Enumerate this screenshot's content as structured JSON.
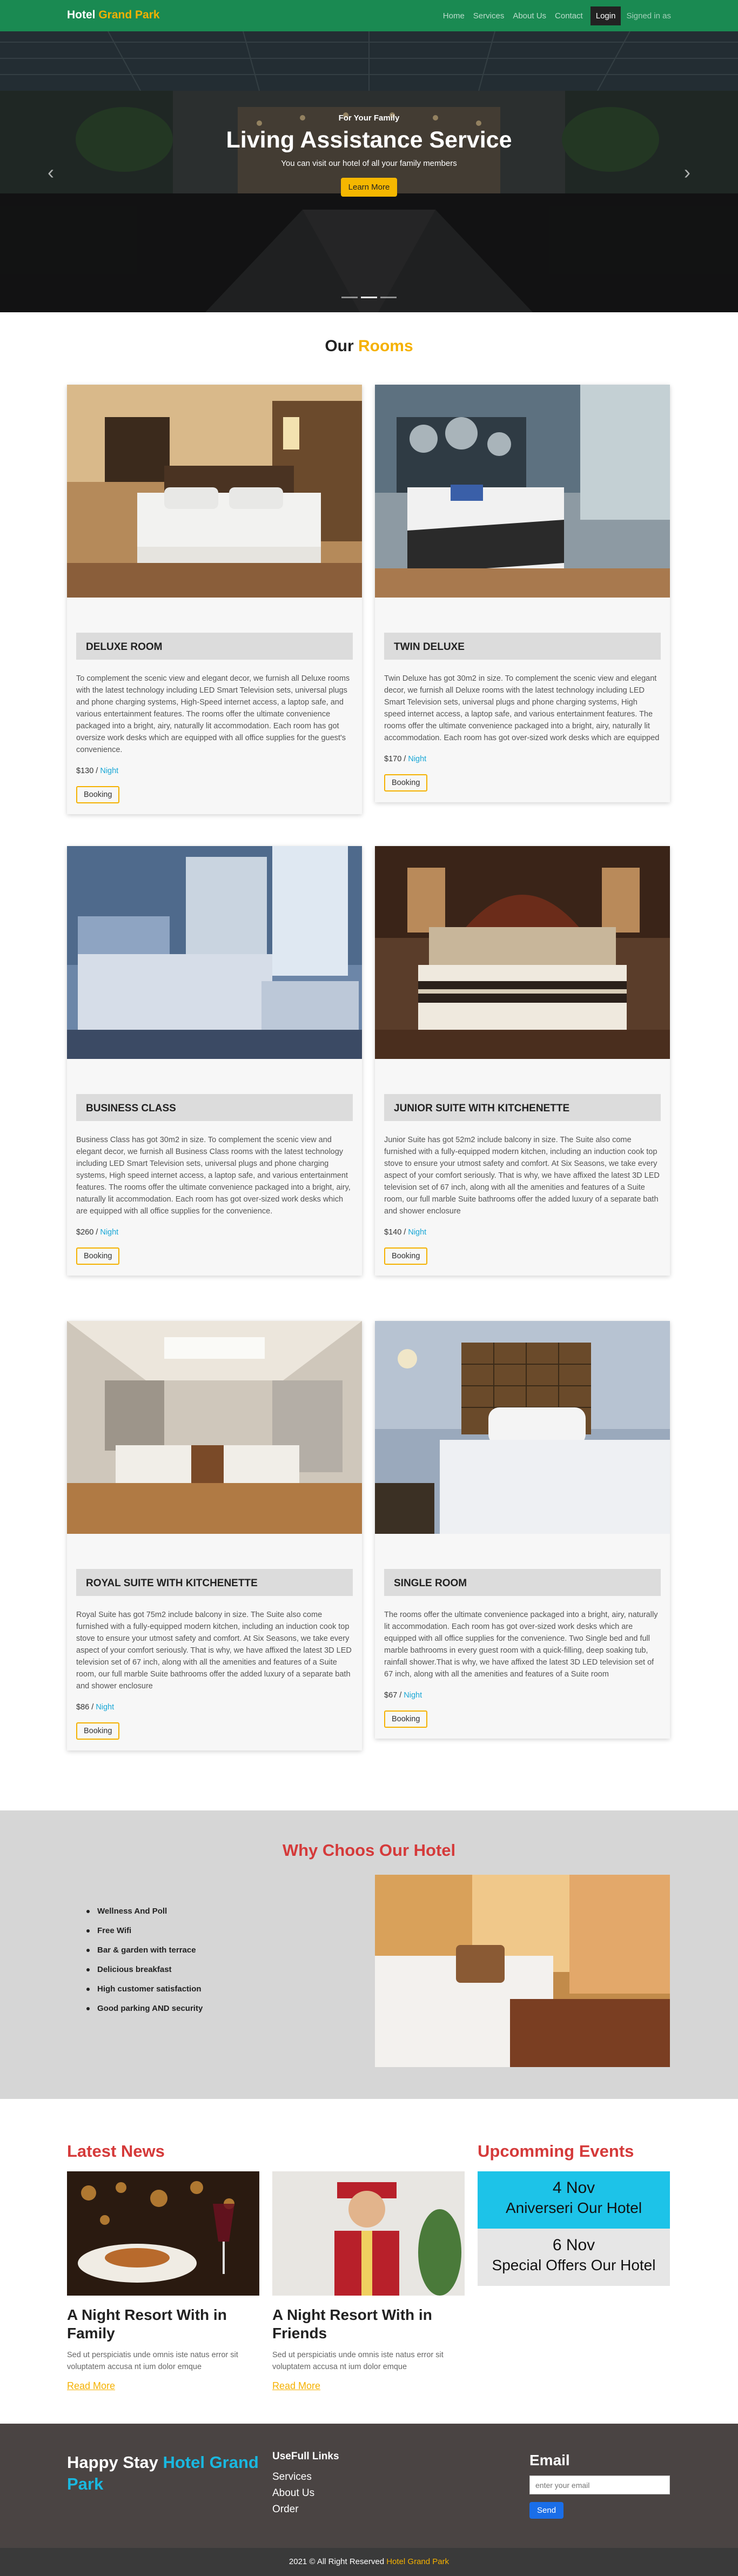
{
  "navbar": {
    "brand_part1": "Hotel ",
    "brand_part2": "Grand Park",
    "links": [
      "Home",
      "Services",
      "About Us",
      "Contact"
    ],
    "login": "Login",
    "signed": "Signed in as"
  },
  "hero": {
    "small": "For Your Family",
    "title": "Living Assistance Service",
    "subtitle": "You can visit our hotel of all your family members",
    "button": "Learn More",
    "slides_total": 3,
    "active_slide": 2
  },
  "rooms": {
    "title_part1": "Our ",
    "title_part2": "Rooms",
    "items": [
      {
        "name": "DELUXE ROOM",
        "description": "To complement the scenic view and elegant decor, we furnish all Deluxe rooms with the latest technology including LED Smart Television sets, universal plugs and phone charging systems, High-Speed internet access, a laptop safe, and various entertainment features. The rooms offer the ultimate convenience packaged into a bright, airy, naturally lit accommodation. Each room has got oversize work desks which are equipped with all office supplies for the guest's convenience.",
        "price": "$130 / ",
        "price_unit": "Night",
        "button": "Booking"
      },
      {
        "name": "TWIN DELUXE",
        "description": "Twin Deluxe has got 30m2 in size. To complement the scenic view and elegant decor, we furnish all Deluxe rooms with the latest technology including LED Smart Television sets, universal plugs and phone charging systems, High speed internet access, a laptop safe, and various entertainment features. The rooms offer the ultimate convenience packaged into a bright, airy, naturally lit accommodation. Each room has got over-sized work desks which are equipped",
        "price": "$170 / ",
        "price_unit": "Night",
        "button": "Booking"
      },
      {
        "name": "BUSINESS CLASS",
        "description": "Business Class has got 30m2 in size. To complement the scenic view and elegant decor, we furnish all Business Class rooms with the latest technology including LED Smart Television sets, universal plugs and phone charging systems, High speed internet access, a laptop safe, and various entertainment features. The rooms offer the ultimate convenience packaged into a bright, airy, naturally lit accommodation. Each room has got over-sized work desks which are equipped with all office supplies for the convenience.",
        "price": "$260 / ",
        "price_unit": "Night",
        "button": "Booking"
      },
      {
        "name": "JUNIOR SUITE WITH KITCHENETTE",
        "description": "Junior Suite has got 52m2 include balcony in size. The Suite also come furnished with a fully-equipped modern kitchen, including an induction cook top stove to ensure your utmost safety and comfort. At Six Seasons, we take every aspect of your comfort seriously. That is why, we have affixed the latest 3D LED television set of 67 inch, along with all the amenities and features of a Suite room, our full marble Suite bathrooms offer the added luxury of a separate bath and shower enclosure",
        "price": "$140 / ",
        "price_unit": "Night",
        "button": "Booking"
      },
      {
        "name": "ROYAL SUITE WITH KITCHENETTE",
        "description": "Royal Suite has got 75m2 include balcony in size. The Suite also come furnished with a fully-equipped modern kitchen, including an induction cook top stove to ensure your utmost safety and comfort. At Six Seasons, we take every aspect of your comfort seriously. That is why, we have affixed the latest 3D LED television set of 67 inch, along with all the amenities and features of a Suite room, our full marble Suite bathrooms offer the added luxury of a separate bath and shower enclosure",
        "price": "$86 / ",
        "price_unit": "Night",
        "button": "Booking"
      },
      {
        "name": "SINGLE ROOM",
        "description": "The rooms offer the ultimate convenience packaged into a bright, airy, naturally lit accommodation. Each room has got over-sized work desks which are equipped with all office supplies for the convenience. Two Single bed and full marble bathrooms in every guest room with a quick-filling, deep soaking tub, rainfall shower.That is why, we have affixed the latest 3D LED television set of 67 inch, along with all the amenities and features of a Suite room",
        "price": "$67 / ",
        "price_unit": "Night",
        "button": "Booking"
      }
    ]
  },
  "why": {
    "title": "Why Choos Our Hotel",
    "items": [
      "Wellness And Poll",
      "Free Wifi",
      "Bar & garden with terrace",
      "Delicious breakfast",
      "High customer satisfaction",
      "Good parking AND security"
    ]
  },
  "news": {
    "heading": "Latest News",
    "items": [
      {
        "title": "A Night Resort With in Family",
        "text": "Sed ut perspiciatis unde omnis iste natus error sit voluptatem accusa nt ium dolor emque",
        "more": "Read More"
      },
      {
        "title": "A Night Resort With in Friends",
        "text": "Sed ut perspiciatis unde omnis iste natus error sit voluptatem accusa nt ium dolor emque",
        "more": "Read More"
      }
    ]
  },
  "events": {
    "heading": "Upcomming Events",
    "items": [
      {
        "date": "4 Nov",
        "name": "Aniverseri Our Hotel",
        "color": "#1dc3e8"
      },
      {
        "date": "6 Nov",
        "name": "Special Offers Our Hotel",
        "color": "#e6e6e6"
      }
    ]
  },
  "footer": {
    "brand_part1": "Happy Stay ",
    "brand_part2": "Hotel Grand Park",
    "links_title": "UseFull Links",
    "links": [
      "Services",
      "About Us",
      "Order"
    ],
    "email_title": "Email",
    "email_placeholder": "enter your email",
    "send": "Send"
  },
  "copyright": {
    "text": "2021 © All Right Reserved ",
    "brand": "Hotel Grand Park"
  },
  "colors": {
    "nav_green": "#1a8a52",
    "accent_yellow": "#f5b100",
    "accent_red": "#d53a3a",
    "accent_cyan": "#19a7d6",
    "footer_bg": "#4a4443"
  }
}
